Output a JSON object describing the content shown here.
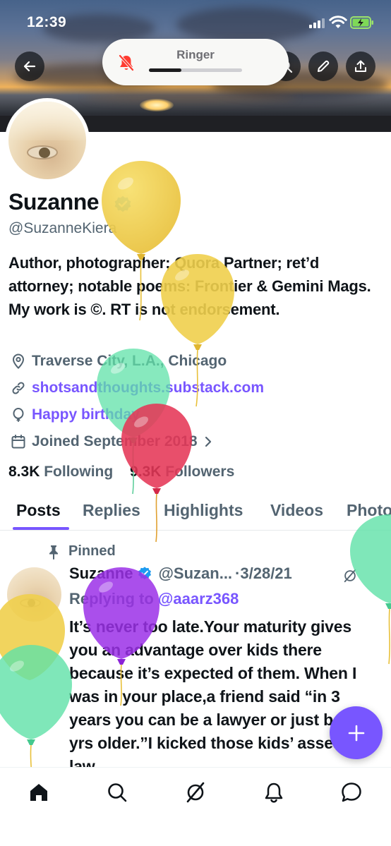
{
  "status_bar": {
    "time": "12:39"
  },
  "ringer": {
    "label": "Ringer",
    "volume_fraction": 0.35
  },
  "profile": {
    "name": "Suzanne",
    "handle": "@SuzanneKiera",
    "bio": "Author, photographer; Quora Partner; ret’d attorney; notable poems: Frontier & Gemini Mags. My work is ©. RT is not endorsement.",
    "location": "Traverse City, L.A., Chicago",
    "website": "shotsandthoughts.substack.com",
    "birthday": "Happy birthday",
    "joined": "Joined September 2018",
    "following_count": "8.3K",
    "following_label": "Following",
    "followers_count": "9.3K",
    "followers_label": "Followers"
  },
  "tabs": [
    "Posts",
    "Replies",
    "Highlights",
    "Videos",
    "Photos"
  ],
  "active_tab": "Posts",
  "tweet": {
    "pinned_label": "Pinned",
    "author_name": "Suzanne",
    "author_handle": "@Suzan...",
    "date": "·3/28/21",
    "replying_prefix": "Replying to",
    "replying_to": "@aaarz368",
    "text": "It’s never too late.Your maturity gives you an advantage over kids there because it’s expected of them. When I was in your place,a friend said “in 3 years you can be a lawyer or just be 3 yrs older.”I kicked those kids’ asses in law"
  },
  "icons": {
    "header": [
      "back-icon",
      "search-icon",
      "edit-icon",
      "share-icon"
    ],
    "nav": [
      "home-icon",
      "search-icon",
      "grok-icon",
      "notifications-icon",
      "messages-icon"
    ]
  },
  "colors": {
    "accent": "#7856ff",
    "text": "#0f1419",
    "muted": "#536471"
  }
}
